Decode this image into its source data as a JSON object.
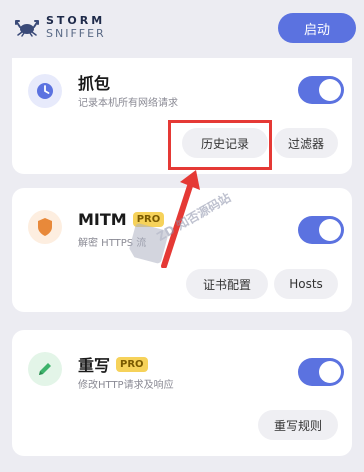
{
  "header": {
    "logo_line1": "STORM",
    "logo_line2": "SNIFFER",
    "start_button": "启动"
  },
  "cards": [
    {
      "title": "抓包",
      "subtitle": "记录本机所有网络请求",
      "enabled": true,
      "buttons": [
        "历史记录",
        "过滤器"
      ]
    },
    {
      "title": "MITM",
      "badge": "PRO",
      "subtitle": "解密 HTTPS 流",
      "enabled": true,
      "buttons": [
        "证书配置",
        "Hosts"
      ]
    },
    {
      "title": "重写",
      "badge": "PRO",
      "subtitle": "修改HTTP请求及响应",
      "enabled": true,
      "buttons": [
        "重写规则"
      ]
    }
  ],
  "watermark": "ZD 知否源码站",
  "colors": {
    "accent": "#5b72e0",
    "highlight": "#e53935",
    "pro_badge": "#f6d25a",
    "background": "#ececf2"
  }
}
